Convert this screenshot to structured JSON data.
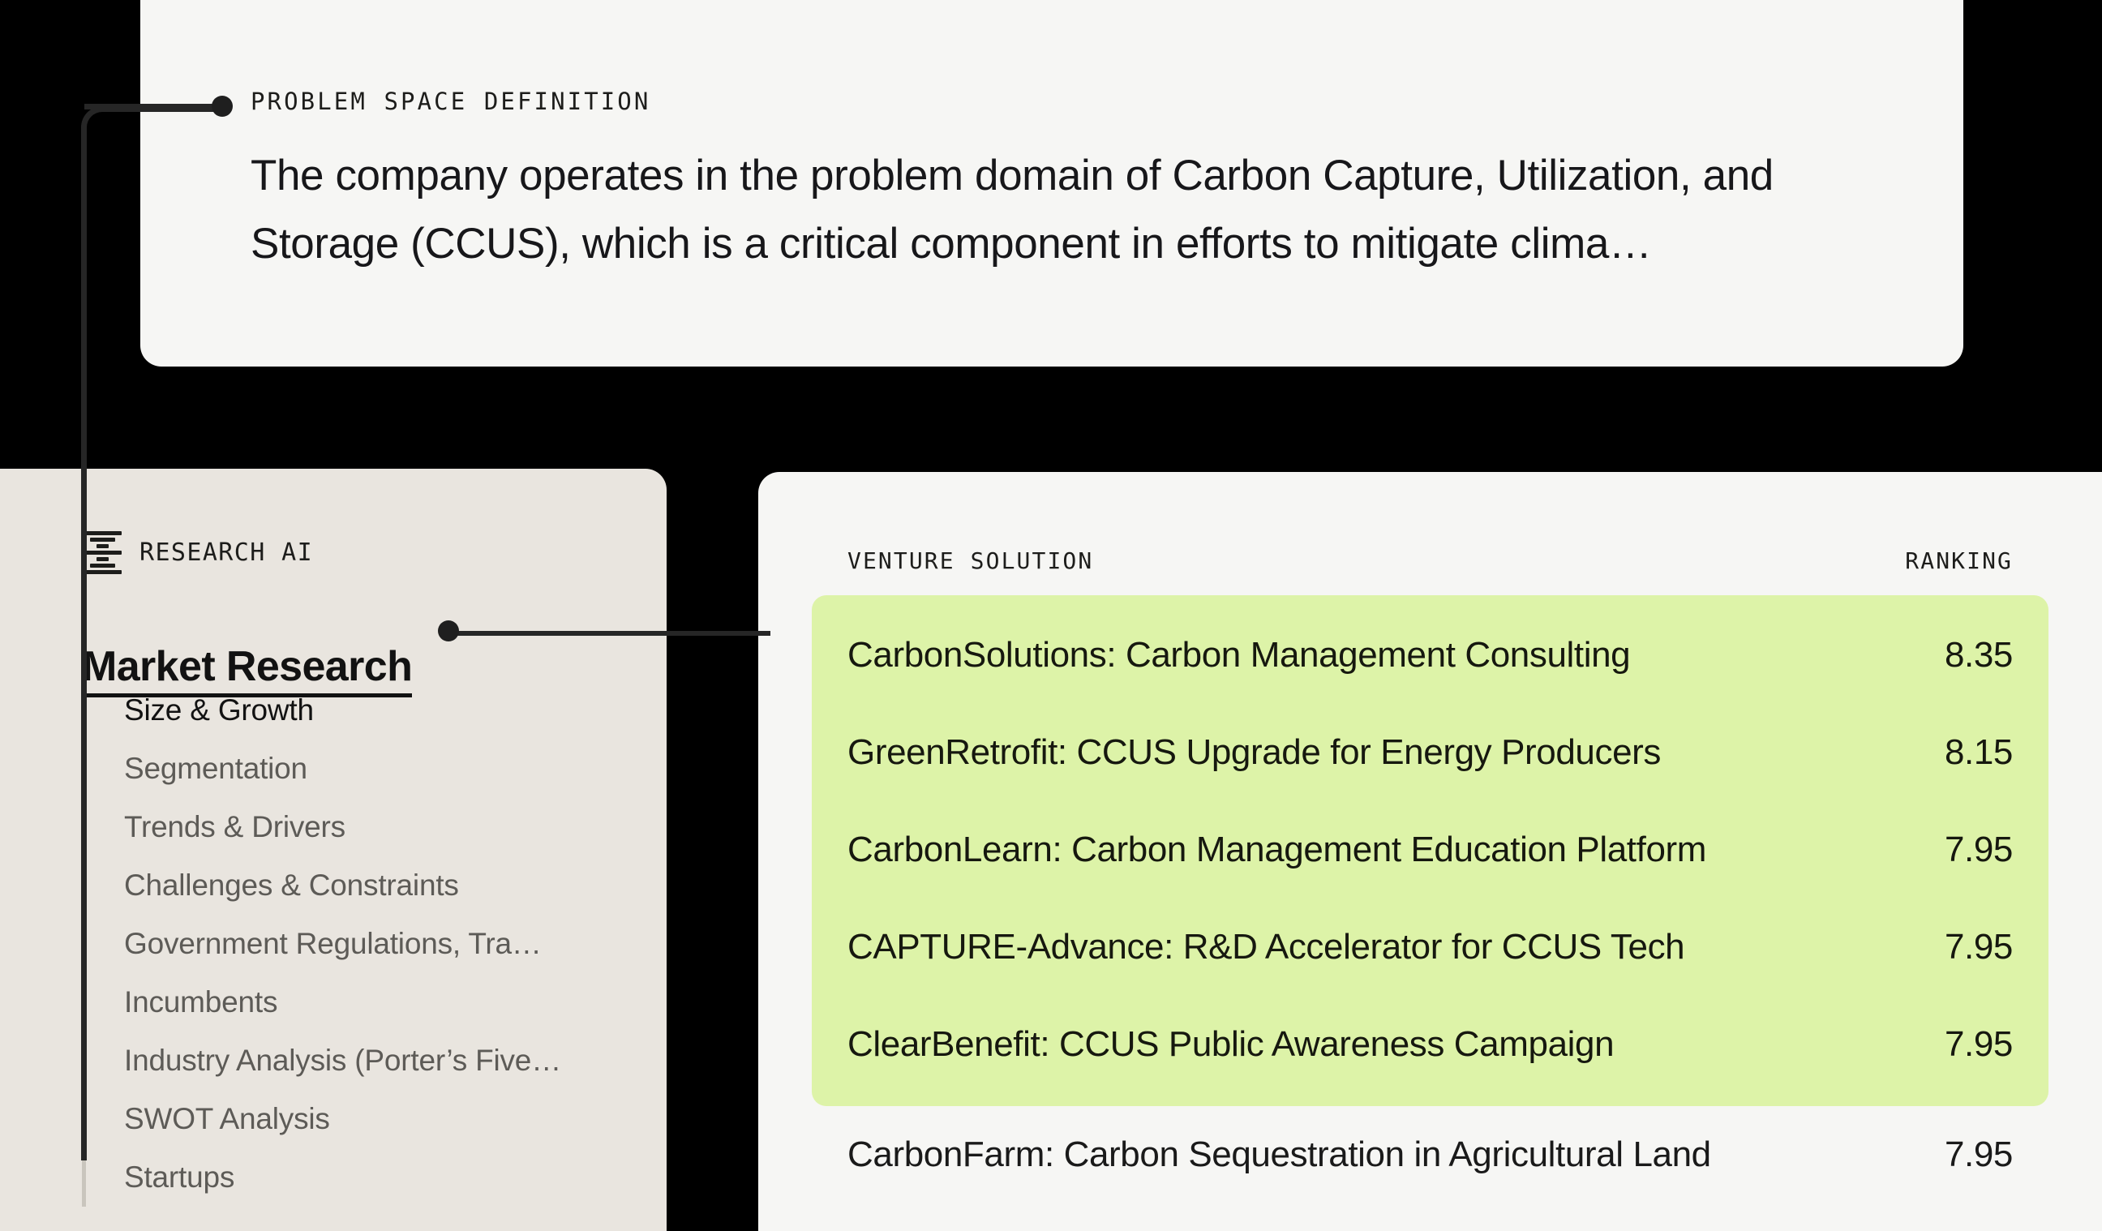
{
  "problem_card": {
    "eyebrow": "PROBLEM SPACE DEFINITION",
    "body": "The company operates in the problem domain of Carbon Capture, Utilization, and Storage (CCUS), which is a critical component in efforts to mitigate clima…"
  },
  "sidebar": {
    "brand": "RESEARCH AI",
    "logo_icon": "stacked-bars-logo-icon",
    "section_title": "Market Research",
    "items": [
      {
        "label": "Size & Growth",
        "active": true
      },
      {
        "label": "Segmentation",
        "active": false
      },
      {
        "label": "Trends & Drivers",
        "active": false
      },
      {
        "label": "Challenges & Constraints",
        "active": false
      },
      {
        "label": "Government Regulations, Tra…",
        "active": false
      },
      {
        "label": "Incumbents",
        "active": false
      },
      {
        "label": "Industry Analysis (Porter’s Five…",
        "active": false
      },
      {
        "label": "SWOT Analysis",
        "active": false
      },
      {
        "label": "Startups",
        "active": false
      }
    ]
  },
  "ventures": {
    "col_solution": "VENTURE SOLUTION",
    "col_ranking": "RANKING",
    "highlight_color": "#ddf3a8",
    "highlighted_rows": [
      {
        "solution": "CarbonSolutions: Carbon Management Consulting",
        "ranking": "8.35"
      },
      {
        "solution": "GreenRetrofit: CCUS Upgrade for Energy Producers",
        "ranking": "8.15"
      },
      {
        "solution": "CarbonLearn: Carbon Management Education Platform",
        "ranking": "7.95"
      },
      {
        "solution": "CAPTURE-Advance: R&D Accelerator for CCUS Tech",
        "ranking": "7.95"
      },
      {
        "solution": "ClearBenefit: CCUS Public Awareness Campaign",
        "ranking": "7.95"
      }
    ],
    "plain_rows": [
      {
        "solution": "CarbonFarm: Carbon Sequestration in Agricultural Land",
        "ranking": "7.95"
      }
    ]
  },
  "colors": {
    "background": "#000000",
    "card_surface": "#f6f6f4",
    "sidebar_surface": "#e9e5df",
    "connector": "#262626",
    "accent_green": "#ddf3a8",
    "text_primary": "#17171a",
    "text_muted": "#5d5b57"
  }
}
